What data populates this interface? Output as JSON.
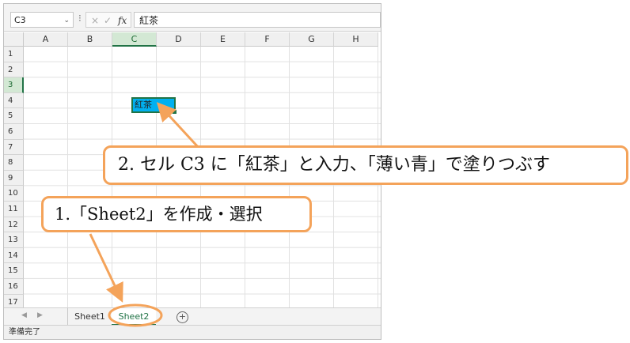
{
  "formula_bar": {
    "name_box": "C3",
    "name_box_dropdown_icon": "chevron-down-icon",
    "separator": "⁝",
    "cancel_icon": "×",
    "enter_icon": "✓",
    "fx_label": "fx",
    "content": "紅茶"
  },
  "grid": {
    "columns": [
      "A",
      "B",
      "C",
      "D",
      "E",
      "F",
      "G",
      "H"
    ],
    "rows": [
      "1",
      "2",
      "3",
      "4",
      "5",
      "6",
      "7",
      "8",
      "9",
      "10",
      "11",
      "12",
      "13",
      "14",
      "15",
      "16",
      "17"
    ],
    "selected_column": "C",
    "selected_row": "3",
    "cell_c3": {
      "value": "紅茶",
      "fill": "#00b0f0"
    }
  },
  "sheet_tabs": {
    "nav_prev": "◀",
    "nav_next": "▶",
    "tabs": [
      {
        "label": "Sheet1",
        "active": false
      },
      {
        "label": "Sheet2",
        "active": true
      }
    ],
    "add_sheet": "+"
  },
  "status_bar": {
    "text": "準備完了"
  },
  "annotations": {
    "callout_1": "1.「Sheet2」を作成・選択",
    "callout_2": "2.  セル C3 に「紅茶」と入力、「薄い青」で塗りつぶす",
    "color": "#f4a35a"
  }
}
